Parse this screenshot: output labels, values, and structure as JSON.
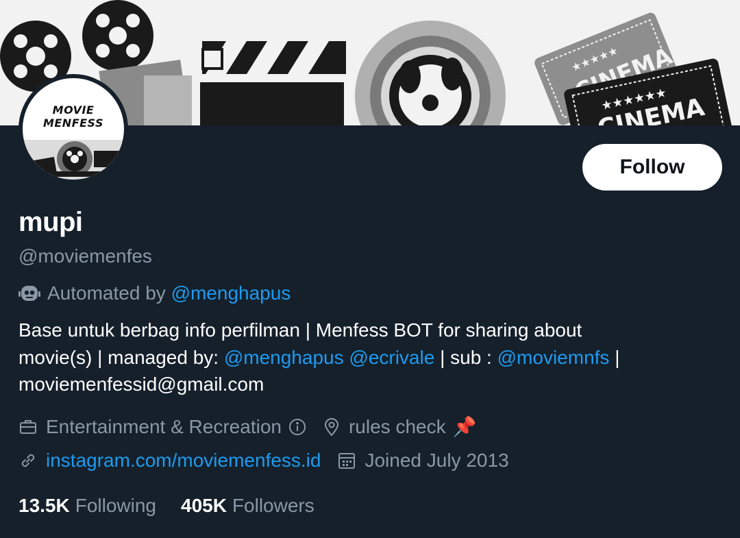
{
  "profile": {
    "avatar_text_line1": "MOVIE",
    "avatar_text_line2": "MENFESS",
    "name": "mupi",
    "handle": "@moviemenfes",
    "automated_prefix": "Automated by",
    "automated_link": "@menghapus",
    "follow_label": "Follow"
  },
  "banner": {
    "ticket_text_1": "CINEMA",
    "ticket_text_2": "CINEMA"
  },
  "bio": {
    "line1": "Base untuk berbag info perfilman | Menfess BOT for sharing about",
    "line2_prefix": "movie(s) | managed by:",
    "mention1": "@menghapus",
    "mention2": "@ecrivale",
    "line2_mid": "| sub :",
    "mention3": "@moviemnfs",
    "line2_suffix": "|",
    "line3": "moviemenfessid@gmail.com"
  },
  "meta": {
    "category": "Entertainment & Recreation",
    "location": "rules check",
    "location_emoji": "📌",
    "website": "instagram.com/moviemenfess.id",
    "joined": "Joined July 2013"
  },
  "stats": {
    "following_count": "13.5K",
    "following_label": "Following",
    "followers_count": "405K",
    "followers_label": "Followers"
  },
  "colors": {
    "background": "#15202b",
    "link": "#1d9bf0",
    "secondary_text": "#8b98a5"
  }
}
